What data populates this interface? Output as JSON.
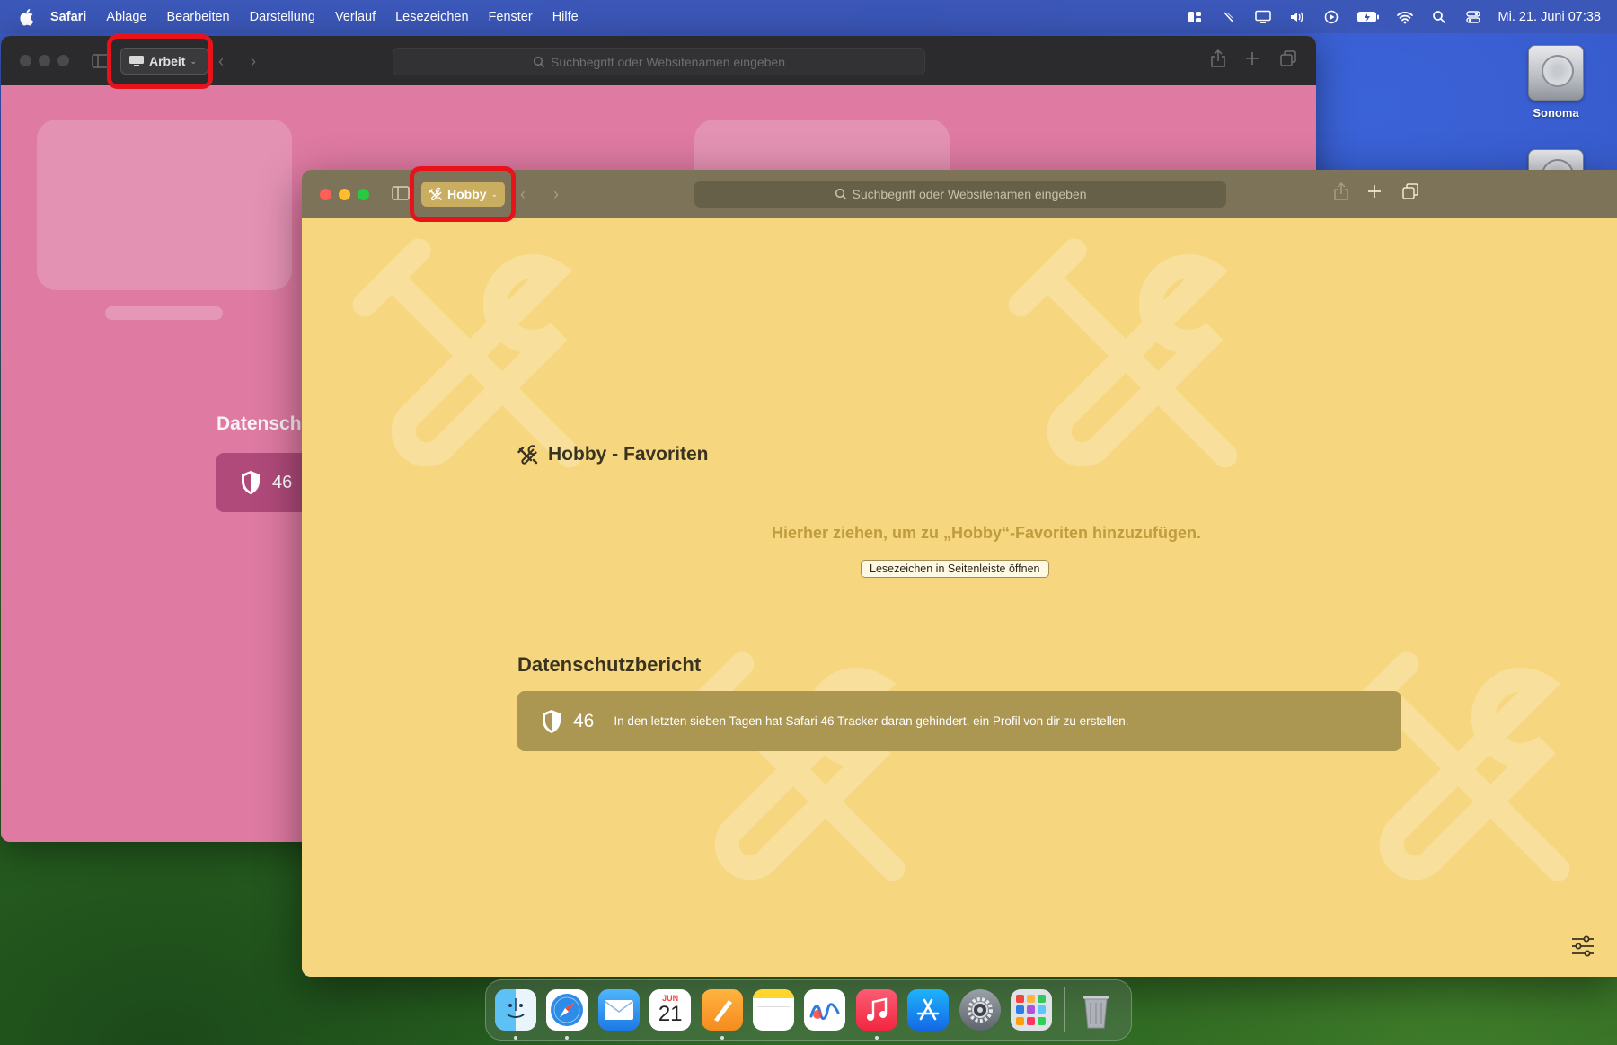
{
  "menubar": {
    "app_name": "Safari",
    "items": [
      "Ablage",
      "Bearbeiten",
      "Darstellung",
      "Verlauf",
      "Lesezeichen",
      "Fenster",
      "Hilfe"
    ],
    "clock": "Mi. 21. Juni  07:38"
  },
  "desktop": {
    "disk_label": "Sonoma"
  },
  "back_window": {
    "profile_label": "Arbeit",
    "address_placeholder": "Suchbegriff oder Websitenamen eingeben",
    "privacy_heading": "Datensch",
    "tracker_count": "46",
    "background_color": "#df7aa3"
  },
  "front_window": {
    "profile_label": "Hobby",
    "address_placeholder": "Suchbegriff oder Websitenamen eingeben",
    "favorites_heading": "Hobby - Favoriten",
    "drop_hint": "Hierher ziehen, um zu „Hobby“-Favoriten hinzuzufügen.",
    "open_sidebar_button": "Lesezeichen in Seitenleiste öffnen",
    "privacy_heading": "Datenschutzbericht",
    "tracker_count": "46",
    "privacy_text": "In den letzten sieben Tagen hat Safari 46 Tracker daran gehindert, ein Profil von dir zu erstellen.",
    "background_color": "#f6d77f"
  },
  "dock": {
    "calendar_month": "JUN",
    "calendar_day": "21",
    "apps": [
      "Finder",
      "Safari",
      "Mail",
      "Kalender",
      "Pages",
      "Notizen",
      "Freeform",
      "Musik",
      "App Store",
      "Systemeinstellungen",
      "Launchpad",
      "Papierkorb"
    ]
  },
  "colors": {
    "highlight": "#e8121a",
    "hobby_accent": "#c9ad60"
  }
}
